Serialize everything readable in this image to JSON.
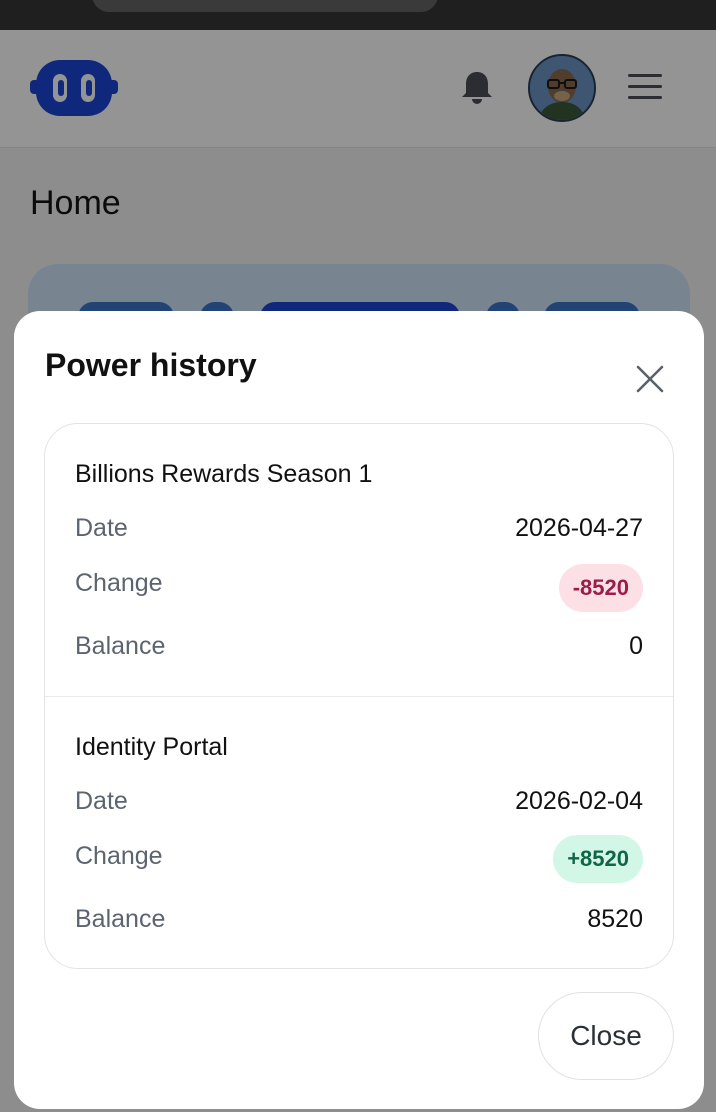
{
  "app": {
    "page_title": "Home"
  },
  "modal": {
    "title": "Power history",
    "entries": [
      {
        "title": "Billions Rewards Season 1",
        "date_label": "Date",
        "date": "2026-04-27",
        "change_label": "Change",
        "change": "-8520",
        "balance_label": "Balance",
        "balance": "0"
      },
      {
        "title": "Identity Portal",
        "date_label": "Date",
        "date": "2026-02-04",
        "change_label": "Change",
        "change": "+8520",
        "balance_label": "Balance",
        "balance": "8520"
      }
    ],
    "close_label": "Close"
  },
  "icons": {
    "logo": "robot-logo-icon",
    "notifications": "bell-icon",
    "profile": "avatar",
    "menu": "hamburger-menu-icon",
    "dismiss": "close-icon"
  },
  "colors": {
    "brand": "#1a45d6",
    "negative_badge_bg": "#fde0e6",
    "negative_badge_text": "#9c1d4a",
    "positive_badge_bg": "#d2f7e7",
    "positive_badge_text": "#11664a"
  }
}
